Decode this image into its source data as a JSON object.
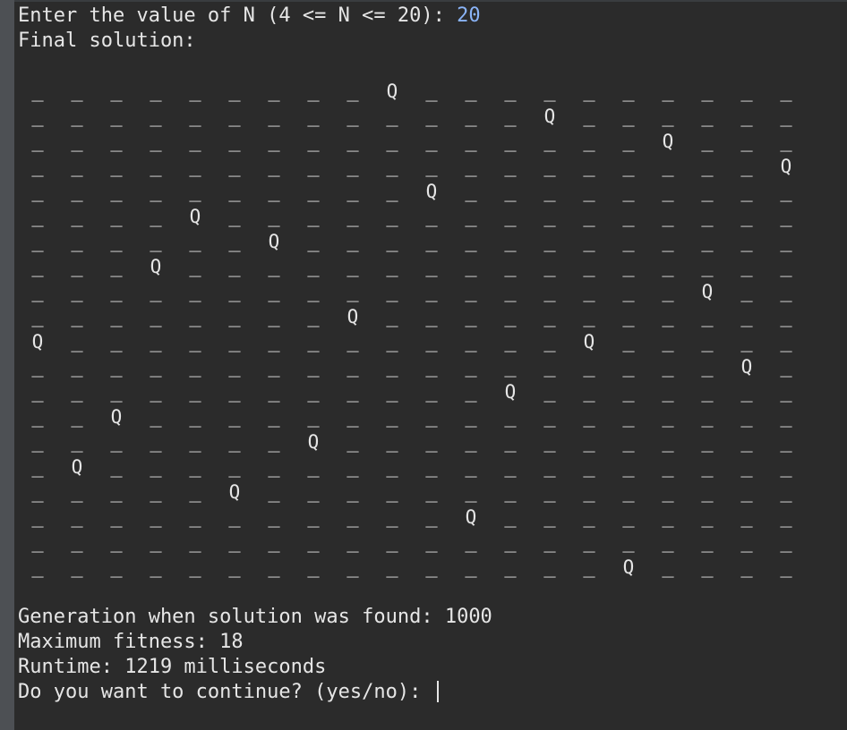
{
  "terminal": {
    "prompt_text": "Enter the value of N (4 <= N <= 20): ",
    "prompt_input": "20",
    "final_solution_label": "Final solution:",
    "generation_line": "Generation when solution was found: 1000",
    "fitness_line": "Maximum fitness: 18",
    "runtime_line": "Runtime: 1219 milliseconds",
    "continue_prompt": "Do you want to continue? (yes/no): "
  },
  "board": {
    "n": 20,
    "queen_symbol": "Q",
    "empty_symbol": "_",
    "queen_rows": [
      10,
      15,
      13,
      7,
      5,
      16,
      6,
      14,
      9,
      0,
      4,
      17,
      12,
      1,
      10,
      19,
      2,
      8,
      11,
      3
    ]
  }
}
